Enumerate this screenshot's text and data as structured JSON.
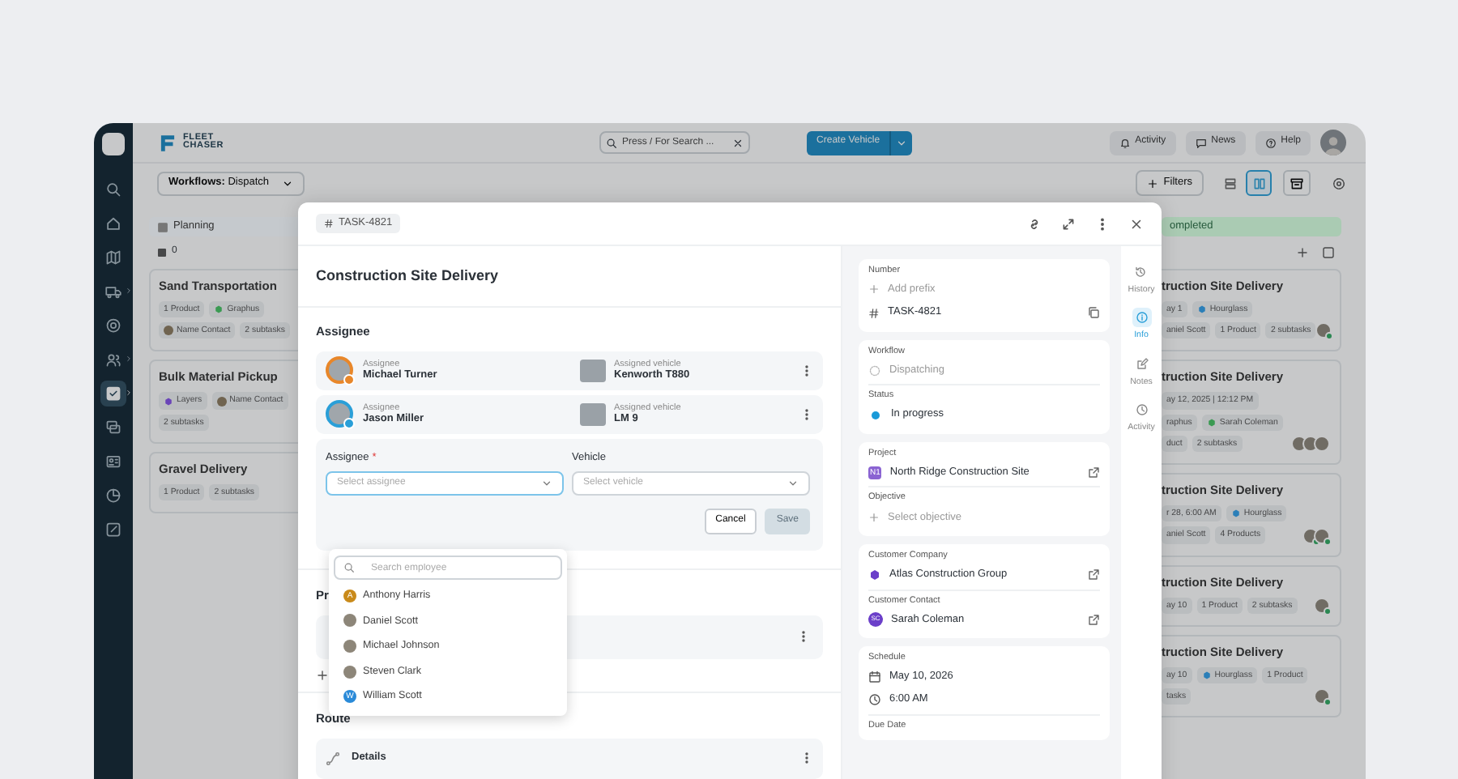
{
  "nav_rail": {
    "items": [
      {
        "kind": "search",
        "selected": false,
        "submenu": false
      },
      {
        "kind": "home",
        "selected": false,
        "submenu": false
      },
      {
        "kind": "map",
        "selected": false,
        "submenu": false
      },
      {
        "kind": "truck",
        "selected": false,
        "submenu": true
      },
      {
        "kind": "target",
        "selected": false,
        "submenu": false
      },
      {
        "kind": "users",
        "selected": false,
        "submenu": true
      },
      {
        "kind": "tasks",
        "selected": true,
        "submenu": true
      },
      {
        "kind": "chat",
        "selected": false,
        "submenu": false
      },
      {
        "kind": "card",
        "selected": false,
        "submenu": false
      },
      {
        "kind": "chart",
        "selected": false,
        "submenu": false
      },
      {
        "kind": "edit",
        "selected": false,
        "submenu": false
      }
    ]
  },
  "topbar": {
    "logo": [
      "FLEET",
      "CHASER"
    ],
    "search": {
      "placeholder": "Press / For Search ..."
    },
    "create_button": "Create Vehicle",
    "buttons": [
      {
        "kind": "bell",
        "label": "Activity"
      },
      {
        "kind": "chat",
        "label": "News"
      },
      {
        "kind": "help",
        "label": "Help"
      }
    ]
  },
  "toolbar": {
    "workflow": "**Workflows:** Dispatch",
    "filters": "Filters",
    "views": [
      {
        "kind": "list",
        "selected": false
      },
      {
        "kind": "board",
        "selected": true
      }
    ]
  },
  "board": {
    "columns": [
      {
        "title": "Planning",
        "color": "#c5c9cd",
        "count": "0",
        "cards": [
          {
            "title": "Sand Transportation",
            "tag_rows": [
              [
                {
                  "text": "1 Product",
                  "kind": "plain"
                },
                {
                  "text": "Graphus",
                  "kind": "app",
                  "color": "#3a9a52"
                }
              ],
              [
                {
                  "text": "Name Contact",
                  "kind": "person"
                },
                {
                  "text": "2 subtasks",
                  "kind": "plain"
                }
              ]
            ]
          },
          {
            "title": "Bulk Material Pickup",
            "tag_rows": [
              [
                {
                  "text": "Layers",
                  "kind": "app",
                  "color": "#6a45b8"
                },
                {
                  "text": "Name Contact",
                  "kind": "person"
                }
              ],
              [
                {
                  "text": "2 subtasks",
                  "kind": "plain"
                }
              ]
            ]
          },
          {
            "title": "Gravel Delivery",
            "tag_rows": [
              [
                {
                  "text": "1 Product",
                  "kind": "plain"
                },
                {
                  "text": "2 subtasks",
                  "kind": "plain"
                }
              ]
            ]
          }
        ]
      },
      {
        "title": "ompleted",
        "color": "#aacbb3",
        "cards": [
          {
            "title": "truction Site Delivery",
            "tag_rows": [
              [
                {
                  "text": "ay 1",
                  "kind": "plain"
                },
                {
                  "text": "Hourglass",
                  "kind": "app",
                  "color": "#2b7fb8"
                }
              ],
              [
                {
                  "text": "aniel Scott",
                  "kind": "plain"
                },
                {
                  "text": "1 Product",
                  "kind": "plain"
                },
                {
                  "text": "2 subtasks",
                  "kind": "plain"
                }
              ]
            ],
            "avatars": [
              {
                "online": true
              }
            ]
          },
          {
            "title": "truction Site Delivery",
            "tag_rows": [
              [
                {
                  "text": "ay 12, 2025 | 12:12 PM",
                  "kind": "plain"
                }
              ],
              [
                {
                  "text": "raphus",
                  "kind": "plain"
                },
                {
                  "text": "Sarah Coleman",
                  "kind": "app",
                  "color": "#3a9a52"
                }
              ],
              [
                {
                  "text": "duct",
                  "kind": "plain"
                },
                {
                  "text": "2 subtasks",
                  "kind": "plain"
                }
              ]
            ],
            "avatars": [
              {
                "online": false
              },
              {
                "online": false
              },
              {
                "online": false
              }
            ]
          },
          {
            "title": "truction Site Delivery",
            "tag_rows": [
              [
                {
                  "text": "r 28, 6:00 AM",
                  "kind": "plain"
                },
                {
                  "text": "Hourglass",
                  "kind": "app",
                  "color": "#2b7fb8"
                }
              ],
              [
                {
                  "text": "aniel Scott",
                  "kind": "plain"
                },
                {
                  "text": "4 Products",
                  "kind": "plain"
                }
              ]
            ],
            "avatars": [
              {
                "online": true
              },
              {
                "online": true
              }
            ]
          },
          {
            "title": "truction Site Delivery",
            "tag_rows": [
              [
                {
                  "text": "ay 10",
                  "kind": "plain"
                },
                {
                  "text": "1 Product",
                  "kind": "plain"
                },
                {
                  "text": "2 subtasks",
                  "kind": "plain"
                }
              ]
            ],
            "avatars": [
              {
                "online": true
              }
            ]
          },
          {
            "title": "truction Site Delivery",
            "tag_rows": [
              [
                {
                  "text": "ay 10",
                  "kind": "plain"
                },
                {
                  "text": "Hourglass",
                  "kind": "app",
                  "color": "#2b7fb8"
                },
                {
                  "text": "1 Product",
                  "kind": "plain"
                }
              ],
              [
                {
                  "text": "tasks",
                  "kind": "plain"
                }
              ]
            ],
            "avatars": [
              {
                "online": true
              }
            ]
          }
        ]
      }
    ]
  },
  "modal": {
    "task_id": "TASK-4821",
    "title": "Construction Site Delivery",
    "assignee_heading": "Assignee",
    "assignments": [
      {
        "label": "Assignee",
        "name": "Michael Turner",
        "color": "#e8872a",
        "vehicle_label": "Assigned vehicle",
        "vehicle": "Kenworth T880"
      },
      {
        "label": "Assignee",
        "name": "Jason Miller",
        "color": "#2a9fd8",
        "vehicle_label": "Assigned vehicle",
        "vehicle": "LM 9"
      }
    ],
    "form": {
      "assignee_label": "Assignee",
      "required_mark": "*",
      "assignee_placeholder": "Select assignee",
      "vehicle_label": "Vehicle",
      "vehicle_placeholder": "Select vehicle",
      "cancel": "Cancel",
      "save": {
        "label": "Save",
        "disabled": true
      }
    },
    "dropdown": {
      "placeholder": "Search employee",
      "options": [
        {
          "name": "Anthony Harris",
          "initial": "A",
          "color": "#c98a1a"
        },
        {
          "name": "Daniel Scott"
        },
        {
          "name": "Michael Johnson"
        },
        {
          "name": "Steven Clark"
        },
        {
          "name": "William Scott",
          "initial": "W",
          "color": "#2a8ad8"
        }
      ]
    },
    "products_heading": "Pr",
    "route_heading": "Route",
    "route_row": "Details",
    "panel": {
      "number": {
        "label": "Number",
        "add_prefix": "Add prefix",
        "value": "TASK-4821"
      },
      "workflow": {
        "label": "Workflow",
        "value": "Dispatching"
      },
      "status": {
        "label": "Status",
        "value": "In progress",
        "color": "#1a9ad8"
      },
      "project": {
        "label": "Project",
        "badge": "N1",
        "value": "North Ridge Construction Site"
      },
      "objective": {
        "label": "Objective",
        "value": "Select objective"
      },
      "company": {
        "label": "Customer Company",
        "value": "Atlas Construction Group"
      },
      "contact": {
        "label": "Customer Contact",
        "initials": "SC",
        "value": "Sarah Coleman"
      },
      "schedule": {
        "label": "Schedule",
        "date": "May 10, 2026",
        "time": "6:00 AM"
      },
      "due_label": "Due Date"
    },
    "side_tabs": [
      {
        "kind": "history",
        "label": "History",
        "selected": false
      },
      {
        "kind": "info",
        "label": "Info",
        "selected": true
      },
      {
        "kind": "note",
        "label": "Notes",
        "selected": false
      },
      {
        "kind": "clock",
        "label": "Activity",
        "selected": false
      }
    ]
  }
}
